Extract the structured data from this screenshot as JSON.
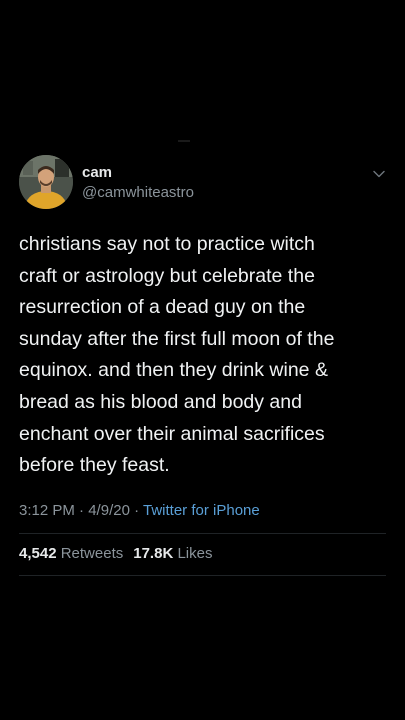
{
  "user": {
    "display_name": "cam",
    "handle": "@camwhiteastro"
  },
  "tweet": {
    "lines": [
      "christians say not to practice witch",
      "craft or astrology but celebrate the",
      "resurrection of a dead guy on the",
      "sunday after the first full moon of the",
      "equinox. and then they drink wine &",
      "bread as his blood and body and",
      "enchant over their animal sacrifices",
      "before they feast."
    ]
  },
  "meta": {
    "time": "3:12 PM",
    "separator": " · ",
    "date": "4/9/20",
    "source": "Twitter for iPhone"
  },
  "stats": {
    "retweets_count": "4,542",
    "retweets_label": "Retweets",
    "likes_count": "17.8K",
    "likes_label": "Likes"
  },
  "icons": {
    "more": "chevron-down-icon",
    "avatar": "avatar"
  },
  "colors": {
    "background": "#000000",
    "text": "#e7e9ea",
    "secondary": "#8b949b",
    "link": "#5a9fd6"
  }
}
